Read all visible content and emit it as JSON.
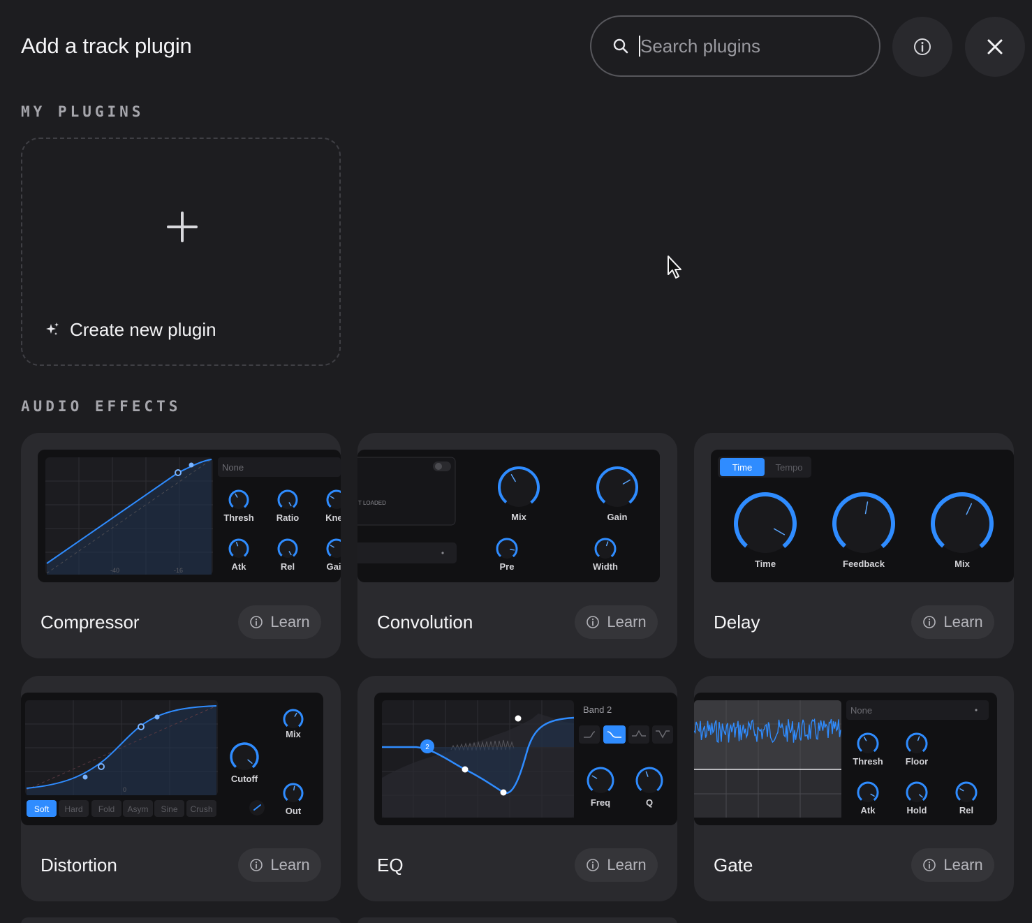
{
  "header": {
    "title": "Add a track plugin"
  },
  "search": {
    "placeholder": "Search plugins"
  },
  "sections": {
    "my_plugins": "MY PLUGINS",
    "audio_effects": "AUDIO EFFECTS"
  },
  "create": {
    "label": "Create new plugin"
  },
  "learn_label": "Learn",
  "plugins": [
    {
      "name": "Compressor"
    },
    {
      "name": "Convolution"
    },
    {
      "name": "Delay"
    },
    {
      "name": "Distortion"
    },
    {
      "name": "EQ"
    },
    {
      "name": "Gate"
    }
  ],
  "previews": {
    "compressor": {
      "preset": "None",
      "knobs": [
        "Thresh",
        "Ratio",
        "Knee",
        "Atk",
        "Rel",
        "Gain"
      ],
      "ticks": [
        "-40",
        "-16"
      ]
    },
    "convolution": {
      "status": "T LOADED",
      "knobs": [
        "Mix",
        "Gain",
        "Pre",
        "Width"
      ]
    },
    "delay": {
      "tabs": [
        "Time",
        "Tempo"
      ],
      "knobs": [
        "Time",
        "Feedback",
        "Mix"
      ]
    },
    "distortion": {
      "knobs": [
        "Cutoff",
        "Mix",
        "Out"
      ],
      "modes": [
        "Soft",
        "Hard",
        "Fold",
        "Asym",
        "Sine",
        "Crush"
      ],
      "tick": "0"
    },
    "eq": {
      "band": "Band 2",
      "band_marker": "2",
      "knobs": [
        "Freq",
        "Q"
      ]
    },
    "gate": {
      "preset": "None",
      "knobs": [
        "Thresh",
        "Floor",
        "Atk",
        "Hold",
        "Rel"
      ]
    }
  },
  "colors": {
    "accent": "#2f8cff",
    "background": "#1d1d20",
    "card": "#2a2a2e"
  }
}
